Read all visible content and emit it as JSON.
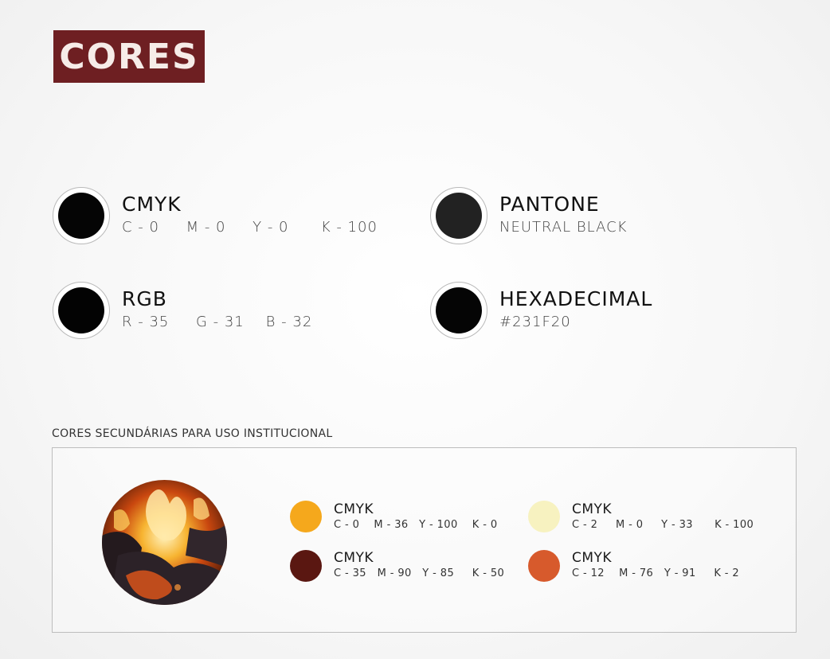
{
  "header": {
    "title": "CORES"
  },
  "primary": [
    {
      "name": "CMYK",
      "values": "C - 0     M - 0     Y - 0      K - 100",
      "color": "#050505"
    },
    {
      "name": "PANTONE",
      "values": "NEUTRAL BLACK",
      "color": "#222222"
    },
    {
      "name": "RGB",
      "values": "R - 35     G - 31    B - 32",
      "color": "#030303"
    },
    {
      "name": "HEXADECIMAL",
      "values": "#231F20",
      "color": "#050505"
    }
  ],
  "secondary": {
    "label": "CORES SECUNDÁRIAS PARA USO INSTITUCIONAL",
    "items": [
      {
        "name": "CMYK",
        "values": "C - 0    M - 36   Y - 100    K - 0",
        "color": "#f5a81c"
      },
      {
        "name": "CMYK",
        "values": "C - 2     M - 0     Y - 33      K - 100",
        "color": "#f7f2c0"
      },
      {
        "name": "CMYK",
        "values": "C - 35   M - 90   Y - 85     K - 50",
        "color": "#5a1711"
      },
      {
        "name": "CMYK",
        "values": "C - 12    M - 76   Y - 91     K - 2",
        "color": "#d75a2c"
      }
    ]
  },
  "colors": {
    "badge": "#6e1f22",
    "badge_text": "#f6ece8"
  }
}
